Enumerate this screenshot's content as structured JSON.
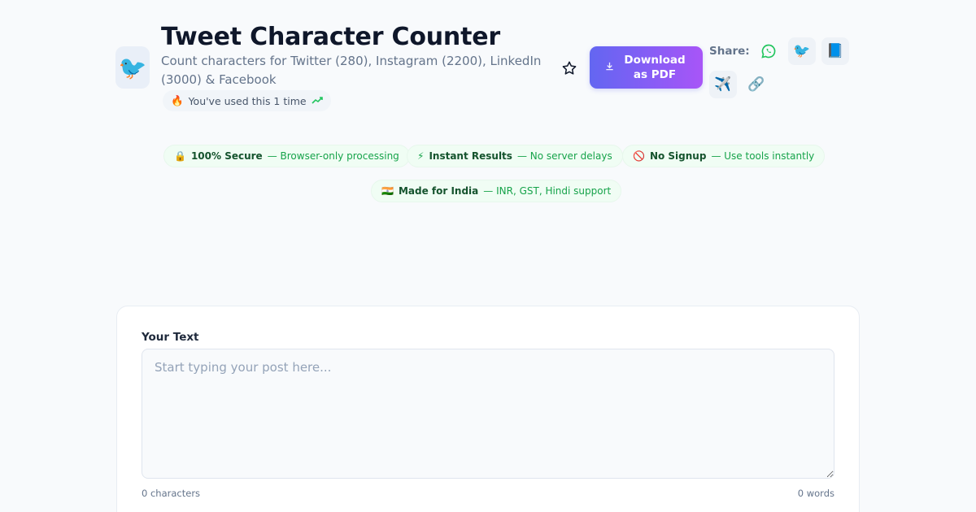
{
  "header": {
    "tool_icon": "bird-icon",
    "tool_icon_glyph": "🐦",
    "title": "Tweet Character Counter",
    "subtitle": "Count characters for Twitter (280), Instagram (2200), LinkedIn (3000) & Facebook",
    "usage": {
      "icon": "fire-icon",
      "glyph": "🔥",
      "text": "You've used this 1 time",
      "trend_icon": "trending-up-icon"
    },
    "favorite_icon": "star-icon",
    "download": {
      "icon": "download-icon",
      "label": "Download as PDF"
    },
    "share": {
      "label": "Share:",
      "buttons": [
        {
          "name": "whatsapp-icon",
          "glyph": "◎",
          "color": "#22c55e"
        },
        {
          "name": "twitter-bird-icon",
          "glyph": "🐦"
        },
        {
          "name": "facebook-book-icon",
          "glyph": "📘"
        },
        {
          "name": "telegram-plane-icon",
          "glyph": "✈️"
        },
        {
          "name": "link-icon",
          "glyph": "🔗"
        }
      ]
    }
  },
  "trust_badges": [
    {
      "icon": "lock-icon",
      "glyph": "🔒",
      "title": "100% Secure",
      "text": "— Browser-only processing"
    },
    {
      "icon": "lightning-icon",
      "glyph": "⚡",
      "title": "Instant Results",
      "text": "— No server delays"
    },
    {
      "icon": "no-entry-icon",
      "glyph": "🚫",
      "title": "No Signup",
      "text": "— Use tools instantly"
    },
    {
      "icon": "india-flag-icon",
      "glyph": "🇮🇳",
      "title": "Made for India",
      "text": "— INR, GST, Hindi support"
    }
  ],
  "editor": {
    "label": "Your Text",
    "value": "",
    "placeholder": "Start typing your post here...",
    "char_count": "0 characters",
    "word_count": "0 words"
  },
  "colors": {
    "accent_start": "#6366f1",
    "accent_end": "#a855f7",
    "success": "#16a34a"
  }
}
